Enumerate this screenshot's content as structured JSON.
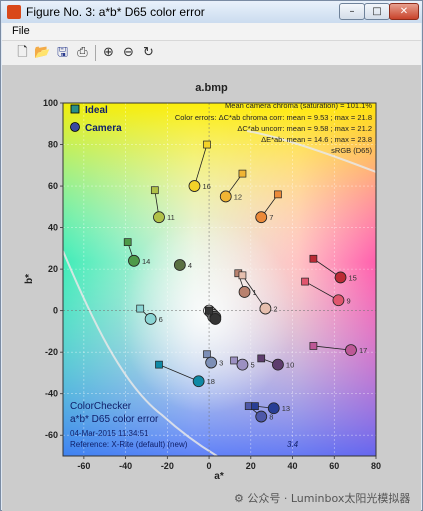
{
  "window": {
    "title": "Figure No. 3: a*b* D65 color error",
    "controls": {
      "minimize": "–",
      "maximize": "□",
      "close": "✕"
    }
  },
  "menu": {
    "file": "File"
  },
  "toolbar": {
    "icons": [
      "new-file-icon",
      "open-folder-icon",
      "save-icon",
      "print-icon",
      "zoom-in-icon",
      "zoom-out-icon",
      "rotate-icon"
    ]
  },
  "plot": {
    "title": "a.bmp",
    "info_lines": [
      "Mean camera chroma (saturation) = 101.1%",
      "Color errors: ΔC*ab chroma corr:  mean = 9.53 ;  max = 21.8",
      "ΔC*ab uncorr:  mean = 9.58 ;  max = 21.2",
      "ΔE*ab:  mean = 14.6 ;  max = 23.8",
      "sRGB (D65)"
    ],
    "bottom_lines": [
      "ColorChecker",
      "a*b* D65 color error",
      "04-Mar-2015 11:34:51",
      "Reference: X-Rite (default) (new)"
    ],
    "corner_value": "3.4",
    "legend": {
      "ideal": "Ideal",
      "camera": "Camera"
    }
  },
  "chart_data": {
    "type": "scatter",
    "title": "a.bmp",
    "xlabel": "a*",
    "ylabel": "b*",
    "xlim": [
      -70,
      80
    ],
    "ylim": [
      -70,
      100
    ],
    "xticks": [
      -60,
      -40,
      -20,
      0,
      20,
      40,
      60,
      80
    ],
    "yticks": [
      -60,
      -40,
      -20,
      0,
      20,
      40,
      60,
      80,
      100
    ],
    "grid": true,
    "legend_position": "top-left",
    "series": [
      {
        "name": "Ideal",
        "marker": "square"
      },
      {
        "name": "Camera",
        "marker": "circle"
      }
    ],
    "patches": [
      {
        "label": "1",
        "ideal": [
          14,
          18
        ],
        "camera": [
          17,
          9
        ],
        "color": "#b9826f"
      },
      {
        "label": "2",
        "ideal": [
          16,
          17
        ],
        "camera": [
          27,
          1
        ],
        "color": "#e6bfae"
      },
      {
        "label": "3",
        "ideal": [
          -1,
          -21
        ],
        "camera": [
          1,
          -25
        ],
        "color": "#7d8fb6"
      },
      {
        "label": "4",
        "ideal": [
          -14,
          22
        ],
        "camera": [
          -14,
          22
        ],
        "color": "#5a7042"
      },
      {
        "label": "5",
        "ideal": [
          12,
          -24
        ],
        "camera": [
          16,
          -26
        ],
        "color": "#9c90c2"
      },
      {
        "label": "6",
        "ideal": [
          -33,
          1
        ],
        "camera": [
          -28,
          -4
        ],
        "color": "#8ad5d4"
      },
      {
        "label": "7",
        "ideal": [
          33,
          56
        ],
        "camera": [
          25,
          45
        ],
        "color": "#eb8a3a"
      },
      {
        "label": "8",
        "ideal": [
          19,
          -46
        ],
        "camera": [
          25,
          -51
        ],
        "color": "#4e58a8"
      },
      {
        "label": "9",
        "ideal": [
          46,
          14
        ],
        "camera": [
          62,
          5
        ],
        "color": "#e0566e"
      },
      {
        "label": "10",
        "ideal": [
          25,
          -23
        ],
        "camera": [
          33,
          -26
        ],
        "color": "#5e3d6e"
      },
      {
        "label": "11",
        "ideal": [
          -26,
          58
        ],
        "camera": [
          -24,
          45
        ],
        "color": "#b0c048"
      },
      {
        "label": "12",
        "ideal": [
          16,
          66
        ],
        "camera": [
          8,
          55
        ],
        "color": "#f0b534"
      },
      {
        "label": "13",
        "ideal": [
          22,
          -46
        ],
        "camera": [
          31,
          -47
        ],
        "color": "#283e95"
      },
      {
        "label": "14",
        "ideal": [
          -39,
          33
        ],
        "camera": [
          -36,
          24
        ],
        "color": "#4e9a49"
      },
      {
        "label": "15",
        "ideal": [
          50,
          25
        ],
        "camera": [
          63,
          16
        ],
        "color": "#bc2b35"
      },
      {
        "label": "16",
        "ideal": [
          -1,
          80
        ],
        "camera": [
          -7,
          60
        ],
        "color": "#f3d228"
      },
      {
        "label": "17",
        "ideal": [
          50,
          -17
        ],
        "camera": [
          68,
          -19
        ],
        "color": "#bd5896"
      },
      {
        "label": "18",
        "ideal": [
          -24,
          -26
        ],
        "camera": [
          -5,
          -34
        ],
        "color": "#1089a5"
      },
      {
        "label": "",
        "ideal": [
          0,
          0
        ],
        "camera": [
          0,
          0
        ],
        "color": "#ffffff"
      },
      {
        "label": "",
        "ideal": [
          0,
          0
        ],
        "camera": [
          1,
          -1
        ],
        "color": "#c8c8c8"
      },
      {
        "label": "",
        "ideal": [
          0,
          0
        ],
        "camera": [
          2,
          -2
        ],
        "color": "#a0a0a0"
      },
      {
        "label": "",
        "ideal": [
          0,
          0
        ],
        "camera": [
          2,
          -3
        ],
        "color": "#7a7a7a"
      },
      {
        "label": "",
        "ideal": [
          0,
          0
        ],
        "camera": [
          3,
          -3
        ],
        "color": "#555555"
      },
      {
        "label": "",
        "ideal": [
          0,
          0
        ],
        "camera": [
          3,
          -4
        ],
        "color": "#343434"
      }
    ]
  }
}
